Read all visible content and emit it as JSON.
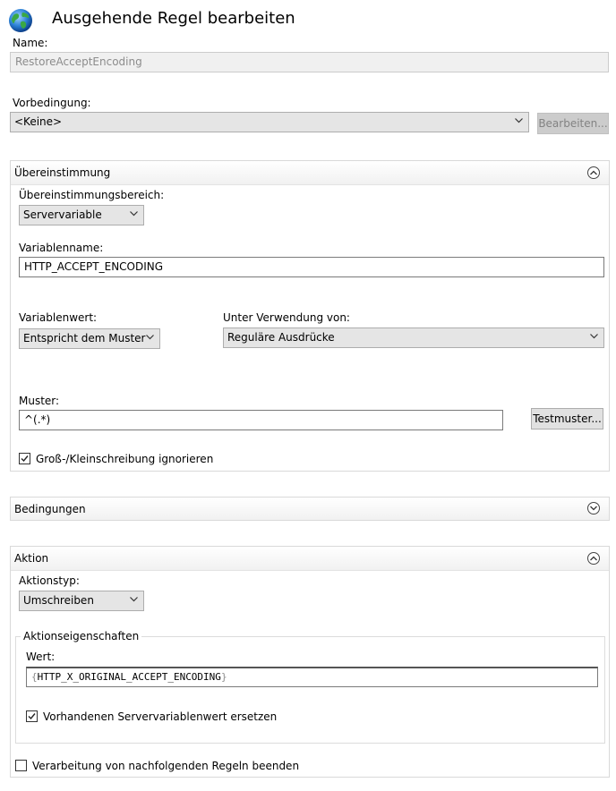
{
  "window": {
    "title": "Ausgehende Regel bearbeiten"
  },
  "name": {
    "label": "Name:",
    "value": "RestoreAcceptEncoding"
  },
  "precondition": {
    "label": "Vorbedingung:",
    "value": "<Keine>",
    "edit_button": "Bearbeiten..."
  },
  "match": {
    "header": "Übereinstimmung",
    "scope_label": "Übereinstimmungsbereich:",
    "scope_value": "Servervariable",
    "varname_label": "Variablenname:",
    "varname_value": "HTTP_ACCEPT_ENCODING",
    "varvalue_label": "Variablenwert:",
    "varvalue_value": "Entspricht dem Muster",
    "using_label": "Unter Verwendung von:",
    "using_value": "Reguläre Ausdrücke",
    "pattern_label": "Muster:",
    "pattern_value": "^(.*)",
    "test_button": "Testmuster...",
    "ignore_case_label": "Groß-/Kleinschreibung ignorieren",
    "ignore_case_checked": true
  },
  "conditions": {
    "header": "Bedingungen"
  },
  "action": {
    "header": "Aktion",
    "type_label": "Aktionstyp:",
    "type_value": "Umschreiben",
    "props_legend": "Aktionseigenschaften",
    "value_label": "Wert:",
    "value_open": "{",
    "value_text": "HTTP_X_ORIGINAL_ACCEPT_ENCODING",
    "value_close": "}",
    "replace_label": "Vorhandenen Servervariablenwert ersetzen",
    "replace_checked": true
  },
  "stop_processing": {
    "label": "Verarbeitung von nachfolgenden Regeln beenden",
    "checked": false
  },
  "colors": {
    "accent": "#2a7fd4",
    "disabled_text": "#8c8c8c",
    "section_border": "#d9d9d9"
  }
}
